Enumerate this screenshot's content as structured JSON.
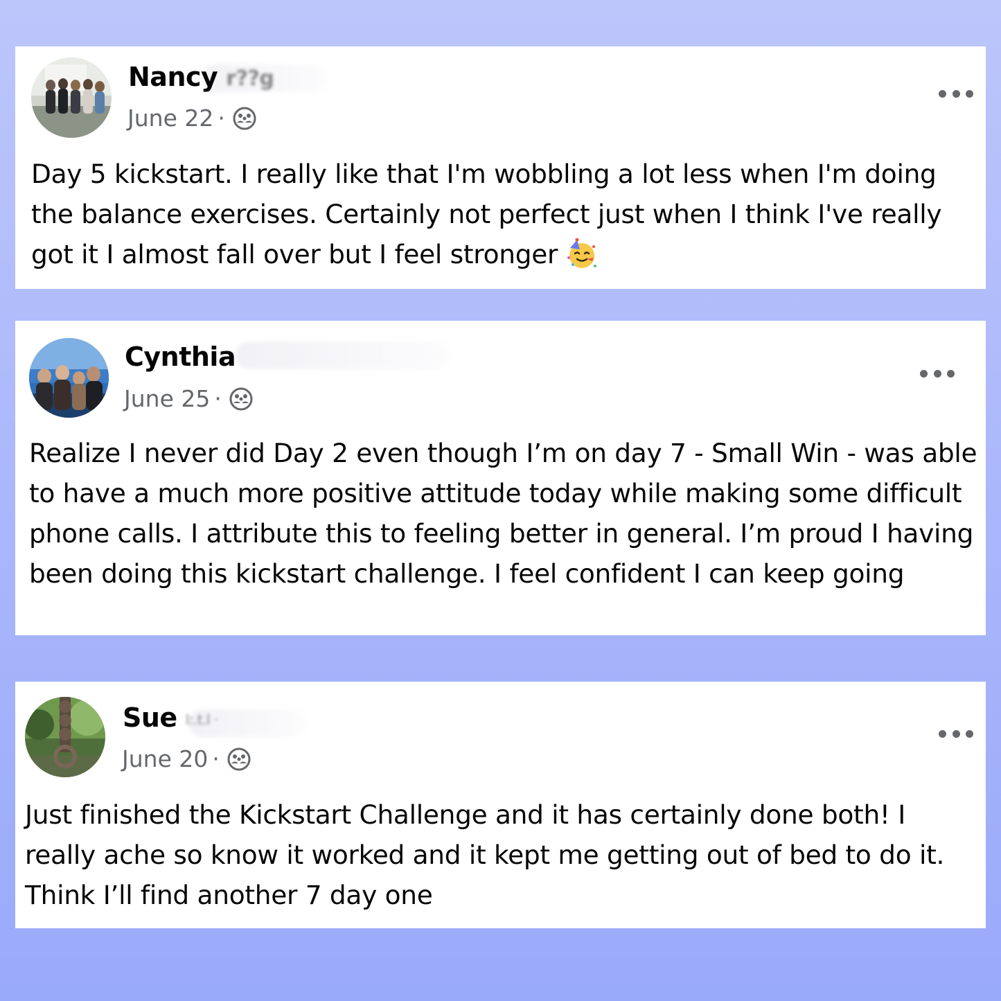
{
  "posts": [
    {
      "author": "Nancy",
      "surname_obscured": "r??g",
      "date": "June 22",
      "separator": "·",
      "audience_icon": "group-icon",
      "more_icon": "more-options-icon",
      "text": "Day 5 kickstart. I really like that I'm wobbling a lot less when I'm doing the balance exercises. Certainly not perfect just when I think I've really got it I almost fall over but I feel stronger",
      "emoji": "partying-face-emoji"
    },
    {
      "author": "Cynthia",
      "surname_obscured": "",
      "date": "June 25",
      "separator": "·",
      "audience_icon": "group-icon",
      "more_icon": "more-options-icon",
      "text": "Realize I never did Day 2 even though I’m on day 7 - Small Win - was able to have a much more positive attitude today while making some difficult phone calls. I attribute this to feeling better in general. I’m proud I having been doing this kickstart challenge. I feel confident I can keep going"
    },
    {
      "author": "Sue",
      "surname_obscured": "l:.t.l ·",
      "date": "June 20",
      "separator": "·",
      "audience_icon": "group-icon",
      "more_icon": "more-options-icon",
      "text": "Just finished the Kickstart Challenge and it has certainly done both! I really ache so know it worked and it kept me getting out of bed to do it. Think I’ll find another 7 day one"
    }
  ],
  "colors": {
    "background_top": "#bcc6fb",
    "background_bottom": "#9aaafa",
    "card": "#ffffff",
    "text": "#050505",
    "meta_text": "#65676b"
  }
}
